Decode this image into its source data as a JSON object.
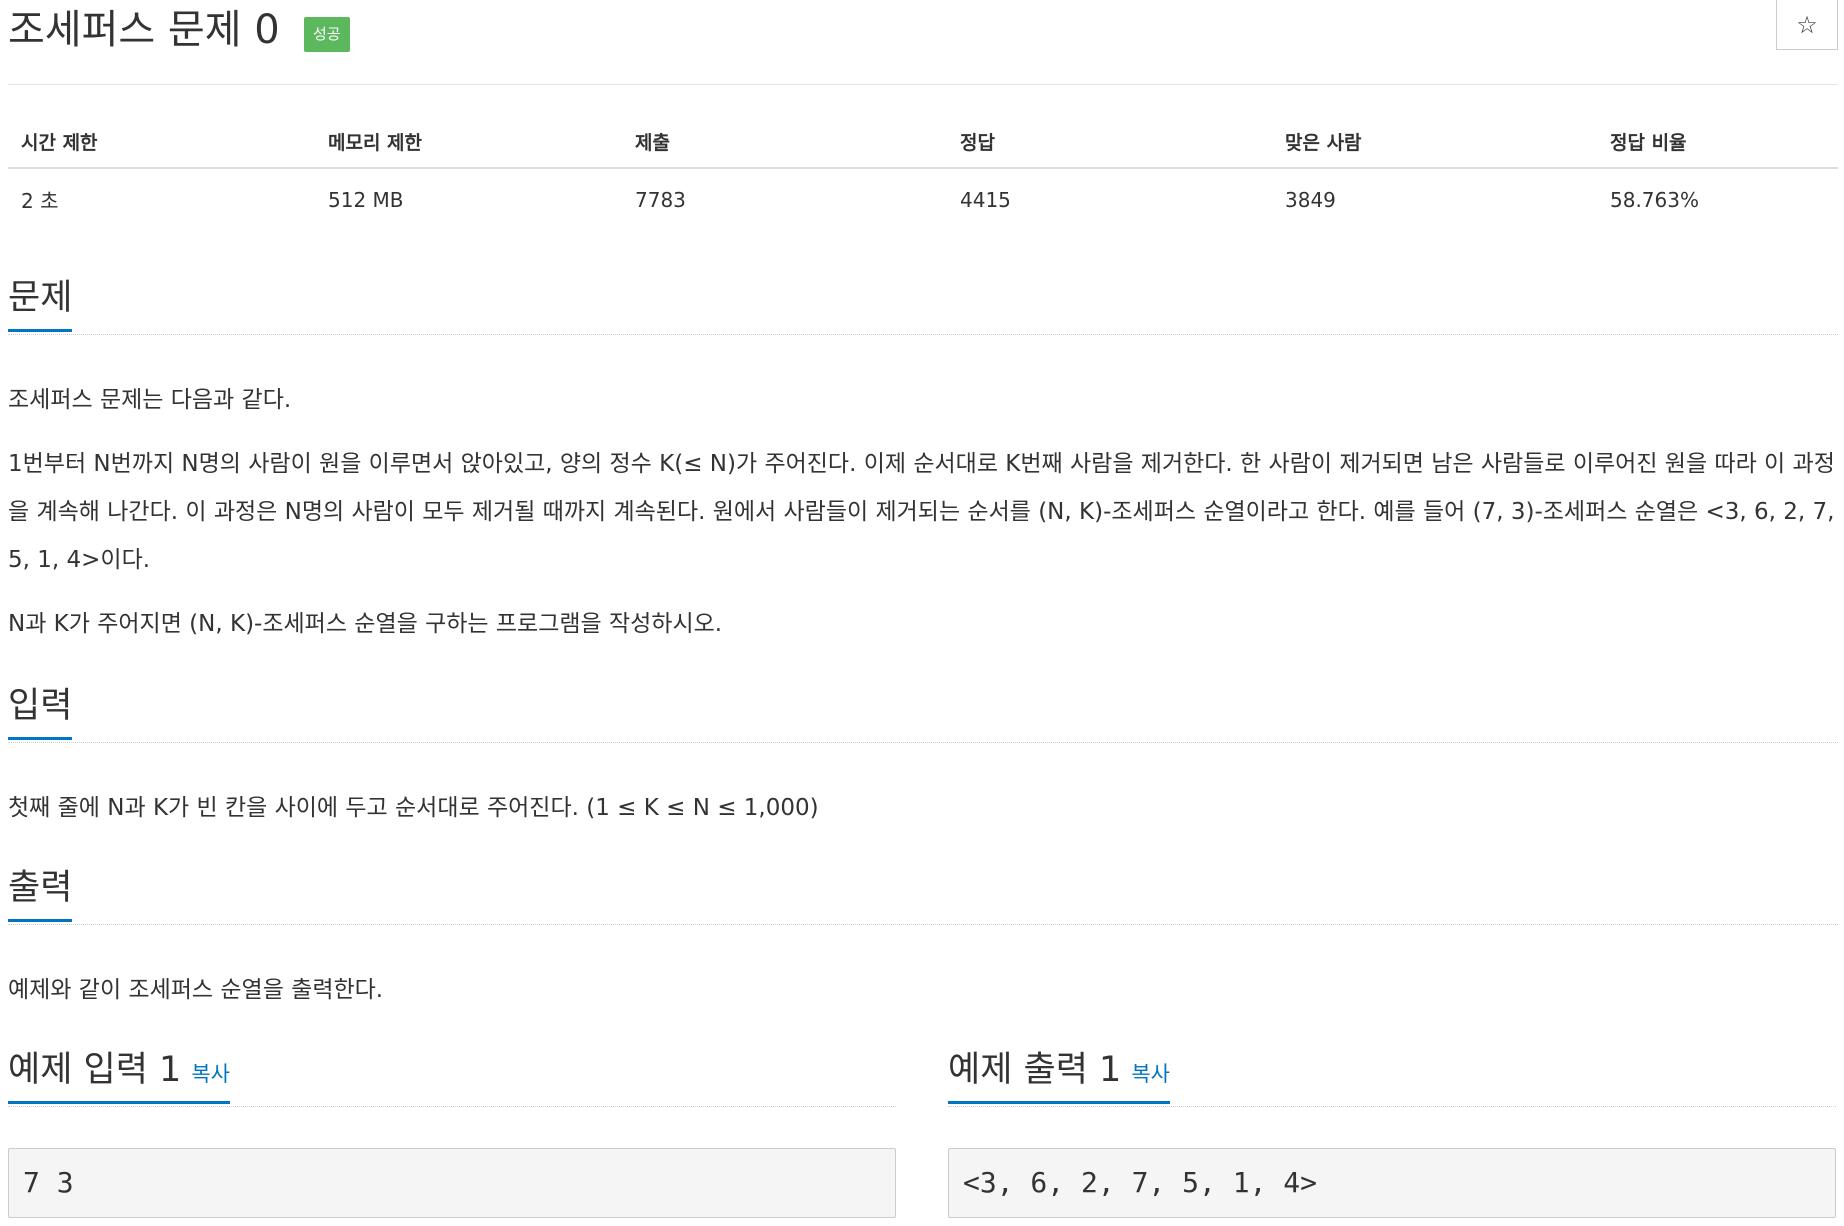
{
  "header": {
    "title": "조세퍼스 문제 0",
    "badge": "성공",
    "star_icon": "☆"
  },
  "info_table": {
    "headers": [
      "시간 제한",
      "메모리 제한",
      "제출",
      "정답",
      "맞은 사람",
      "정답 비율"
    ],
    "values": [
      "2 초",
      "512 MB",
      "7783",
      "4415",
      "3849",
      "58.763%"
    ]
  },
  "sections": {
    "problem": {
      "title": "문제",
      "paragraphs": [
        "조세퍼스 문제는 다음과 같다.",
        "1번부터 N번까지 N명의 사람이 원을 이루면서 앉아있고, 양의 정수 K(≤ N)가 주어진다. 이제 순서대로 K번째 사람을 제거한다. 한 사람이 제거되면 남은 사람들로 이루어진 원을 따라 이 과정을 계속해 나간다. 이 과정은 N명의 사람이 모두 제거될 때까지 계속된다. 원에서 사람들이 제거되는 순서를 (N, K)-조세퍼스 순열이라고 한다. 예를 들어 (7, 3)-조세퍼스 순열은 <3, 6, 2, 7, 5, 1, 4>이다.",
        "N과 K가 주어지면 (N, K)-조세퍼스 순열을 구하는 프로그램을 작성하시오."
      ]
    },
    "input": {
      "title": "입력",
      "text": "첫째 줄에 N과 K가 빈 칸을 사이에 두고 순서대로 주어진다. (1 ≤ K ≤ N ≤ 1,000)"
    },
    "output": {
      "title": "출력",
      "text": "예제와 같이 조세퍼스 순열을 출력한다."
    }
  },
  "samples": {
    "input": {
      "title": "예제 입력 1",
      "copy_label": "복사",
      "content": "7 3"
    },
    "output": {
      "title": "예제 출력 1",
      "copy_label": "복사",
      "content": "<3, 6, 2, 7, 5, 1, 4>"
    }
  },
  "colors": {
    "accent": "#0076c0",
    "success": "#5cb85c"
  }
}
